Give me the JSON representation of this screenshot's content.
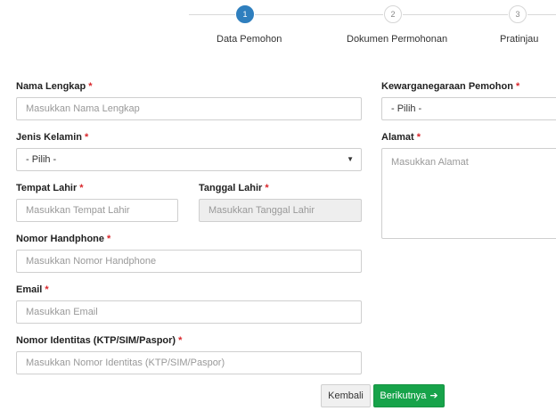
{
  "stepper": {
    "steps": [
      {
        "number": "1",
        "label": "Data Pemohon",
        "state": "active"
      },
      {
        "number": "2",
        "label": "Dokumen Permohonan",
        "state": "inactive"
      },
      {
        "number": "3",
        "label": "Pratinjau",
        "state": "inactive"
      }
    ],
    "active_color": "#2f7fbe"
  },
  "form": {
    "required_mark": "*",
    "nama_lengkap": {
      "label": "Nama Lengkap",
      "placeholder": "Masukkan Nama Lengkap"
    },
    "jenis_kelamin": {
      "label": "Jenis Kelamin",
      "selected": "- Pilih -"
    },
    "tempat_lahir": {
      "label": "Tempat Lahir",
      "placeholder": "Masukkan Tempat Lahir"
    },
    "tanggal_lahir": {
      "label": "Tanggal Lahir",
      "placeholder": "Masukkan Tanggal Lahir"
    },
    "nomor_handphone": {
      "label": "Nomor Handphone",
      "placeholder": "Masukkan Nomor Handphone"
    },
    "email": {
      "label": "Email",
      "placeholder": "Masukkan Email"
    },
    "nomor_identitas": {
      "label": "Nomor Identitas (KTP/SIM/Paspor)",
      "placeholder": "Masukkan Nomor Identitas (KTP/SIM/Paspor)"
    },
    "kewarganegaraan": {
      "label": "Kewarganegaraan Pemohon",
      "selected": "- Pilih -"
    },
    "alamat": {
      "label": "Alamat",
      "placeholder": "Masukkan Alamat"
    }
  },
  "actions": {
    "back_label": "Kembali",
    "next_label": "Berikutnya",
    "next_icon": "arrow-right-icon",
    "next_color": "#17a34a"
  }
}
